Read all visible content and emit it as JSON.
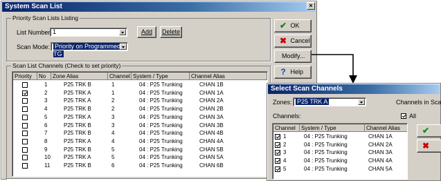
{
  "main_window": {
    "title": "System Scan List",
    "priority_group_label": "Priority Scan Lists Listing",
    "list_number_label": "List Number:",
    "list_number_value": "1",
    "add_label": "Add",
    "delete_label": "Delete",
    "scan_mode_label": "Scan Mode:",
    "scan_mode_value": "Priority on Programmed TG",
    "channels_group_label": "Scan List Channels (Check to set priority)",
    "columns": [
      "Priority",
      "No",
      "Zone Alias",
      "Channel",
      "System / Type",
      "Channel Alias"
    ],
    "rows": [
      {
        "checked": false,
        "no": "1",
        "zone": "P25 TRK B",
        "channel": "1",
        "system": "04 : P25 Trunking",
        "alias": "CHAN 1B"
      },
      {
        "checked": true,
        "no": "2",
        "zone": "P25 TRK A",
        "channel": "1",
        "system": "04 : P25 Trunking",
        "alias": "CHAN 1A"
      },
      {
        "checked": false,
        "no": "3",
        "zone": "P25 TRK A",
        "channel": "2",
        "system": "04 : P25 Trunking",
        "alias": "CHAN 2A"
      },
      {
        "checked": false,
        "no": "4",
        "zone": "P25 TRK B",
        "channel": "2",
        "system": "04 : P25 Trunking",
        "alias": "CHAN 2B"
      },
      {
        "checked": false,
        "no": "5",
        "zone": "P25 TRK A",
        "channel": "3",
        "system": "04 : P25 Trunking",
        "alias": "CHAN 3A"
      },
      {
        "checked": false,
        "no": "6",
        "zone": "P25 TRK B",
        "channel": "3",
        "system": "04 : P25 Trunking",
        "alias": "CHAN 3B"
      },
      {
        "checked": false,
        "no": "7",
        "zone": "P25 TRK B",
        "channel": "4",
        "system": "04 : P25 Trunking",
        "alias": "CHAN 4B"
      },
      {
        "checked": false,
        "no": "8",
        "zone": "P25 TRK A",
        "channel": "4",
        "system": "04 : P25 Trunking",
        "alias": "CHAN 4A"
      },
      {
        "checked": false,
        "no": "9",
        "zone": "P25 TRK B",
        "channel": "5",
        "system": "04 : P25 Trunking",
        "alias": "CHAN 5B"
      },
      {
        "checked": false,
        "no": "10",
        "zone": "P25 TRK A",
        "channel": "5",
        "system": "04 : P25 Trunking",
        "alias": "CHAN 5A"
      },
      {
        "checked": false,
        "no": "11",
        "zone": "P25 TRK B",
        "channel": "6",
        "system": "04 : P25 Trunking",
        "alias": "CHAN 6B"
      }
    ],
    "ok_label": "OK",
    "cancel_label": "Cancel",
    "modify_label": "Modify...",
    "help_label": "Help"
  },
  "select_window": {
    "title": "Select Scan Channels",
    "zones_label": "Zones:",
    "zones_value": "P25 TRK A",
    "channels_in_scan_label": "Channels in Scan",
    "channels_label": "Channels:",
    "all_label": "All",
    "columns": [
      "Channel",
      "System / Type",
      "Channel Alias"
    ],
    "rows": [
      {
        "checked": true,
        "channel": "1",
        "system": "04 : P25 Trunking",
        "alias": "CHAN 1A"
      },
      {
        "checked": true,
        "channel": "2",
        "system": "04 : P25 Trunking",
        "alias": "CHAN 2A"
      },
      {
        "checked": true,
        "channel": "3",
        "system": "04 : P25 Trunking",
        "alias": "CHAN 3A"
      },
      {
        "checked": true,
        "channel": "4",
        "system": "04 : P25 Trunking",
        "alias": "CHAN 4A"
      },
      {
        "checked": true,
        "channel": "5",
        "system": "04 : P25 Trunking",
        "alias": "CHAN 5A"
      }
    ]
  },
  "colors": {
    "ok_icon": "#0a8a1a",
    "cancel_icon": "#cc0000",
    "help_icon": "#1a3fbf",
    "window_face": "#d4d0c8",
    "title_start": "#0a246a"
  }
}
